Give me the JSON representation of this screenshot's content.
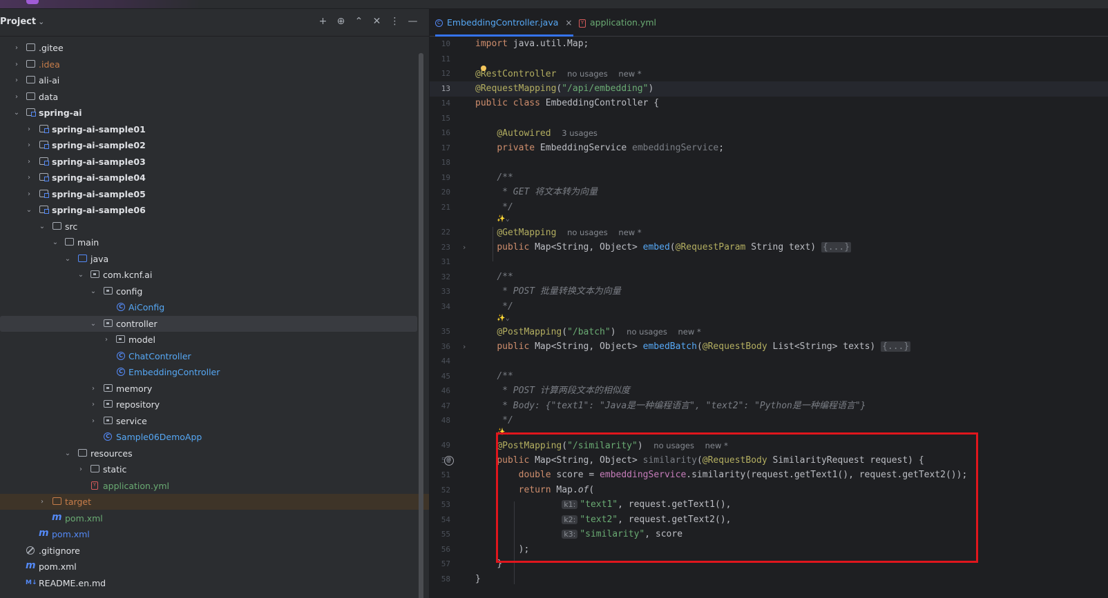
{
  "project": {
    "title": "Project",
    "tools": [
      {
        "name": "add-icon",
        "glyph": "+"
      },
      {
        "name": "locate-icon",
        "glyph": "⊕"
      },
      {
        "name": "expand-all-icon",
        "glyph": "⌃"
      },
      {
        "name": "collapse-all-icon",
        "glyph": "✕"
      },
      {
        "name": "more-options-icon",
        "glyph": "⋮"
      },
      {
        "name": "minimize-icon",
        "glyph": "—"
      }
    ],
    "tree": [
      {
        "label": ".gitee",
        "arrow": "›"
      },
      {
        "label": ".idea",
        "arrow": "›"
      },
      {
        "label": "ali-ai",
        "arrow": "›"
      },
      {
        "label": "data",
        "arrow": "›"
      },
      {
        "label": "spring-ai",
        "arrow": "⌄"
      },
      {
        "label": "spring-ai-sample01",
        "arrow": "›"
      },
      {
        "label": "spring-ai-sample02",
        "arrow": "›"
      },
      {
        "label": "spring-ai-sample03",
        "arrow": "›"
      },
      {
        "label": "spring-ai-sample04",
        "arrow": "›"
      },
      {
        "label": "spring-ai-sample05",
        "arrow": "›"
      },
      {
        "label": "spring-ai-sample06",
        "arrow": "⌄"
      },
      {
        "label": "src",
        "arrow": "⌄"
      },
      {
        "label": "main",
        "arrow": "⌄"
      },
      {
        "label": "java",
        "arrow": "⌄"
      },
      {
        "label": "com.kcnf.ai",
        "arrow": "⌄"
      },
      {
        "label": "config",
        "arrow": "⌄"
      },
      {
        "label": "AiConfig",
        "arrow": ""
      },
      {
        "label": "controller",
        "arrow": "⌄"
      },
      {
        "label": "model",
        "arrow": "›"
      },
      {
        "label": "ChatController",
        "arrow": ""
      },
      {
        "label": "EmbeddingController",
        "arrow": ""
      },
      {
        "label": "memory",
        "arrow": "›"
      },
      {
        "label": "repository",
        "arrow": "›"
      },
      {
        "label": "service",
        "arrow": "›"
      },
      {
        "label": "Sample06DemoApp",
        "arrow": ""
      },
      {
        "label": "resources",
        "arrow": "⌄"
      },
      {
        "label": "static",
        "arrow": "›"
      },
      {
        "label": "application.yml",
        "arrow": ""
      },
      {
        "label": "target",
        "arrow": "›"
      },
      {
        "label": "pom.xml",
        "arrow": ""
      },
      {
        "label": "pom.xml",
        "arrow": ""
      },
      {
        "label": ".gitignore",
        "arrow": ""
      },
      {
        "label": "pom.xml",
        "arrow": ""
      },
      {
        "label": "README.en.md",
        "arrow": ""
      }
    ]
  },
  "editor": {
    "tabs": [
      {
        "label": "EmbeddingController.java",
        "close": "×"
      },
      {
        "label": "application.yml"
      }
    ],
    "line_numbers": [
      "10",
      "11",
      "12",
      "13",
      "14",
      "15",
      "16",
      "17",
      "18",
      "19",
      "20",
      "21",
      "22",
      "23",
      "31",
      "32",
      "33",
      "34",
      "35",
      "36",
      "44",
      "45",
      "46",
      "47",
      "48",
      "49",
      "50",
      "51",
      "52",
      "53",
      "54",
      "55",
      "56",
      "57",
      "58"
    ],
    "code": {
      "l10_kw": "import",
      "l10_rest": " java.util.Map;",
      "l12_a": "@",
      "l12_b": "RestController",
      "hint_no_usages": "no usages",
      "hint_new": "new *",
      "hint_3_usages": "3 usages",
      "l13_an": "@RequestMapping",
      "l13_p1": "(",
      "l13_str": "\"/api/embedding\"",
      "l13_p2": ")",
      "l14_kw": "public class",
      "l14_cls": " EmbeddingController {",
      "l16_an": "@Autowired",
      "l17_kw": "private",
      "l17_type": " EmbeddingService ",
      "l17_fld": "embeddingService",
      "l17_end": ";",
      "c_open": "/**",
      "c_close": " */",
      "l20": " * GET 将文本转为向量",
      "ai_mark": "✨⌄",
      "l22_an": "@GetMapping",
      "pub": "public",
      "map_type": " Map<String, Object> ",
      "l23_fn": "embed",
      "l23_p": "(",
      "l23_an": "@RequestParam",
      "l23_rest": " String text) ",
      "fold": "{...}",
      "l33": " * POST 批量转换文本为向量",
      "l35_an": "@PostMapping",
      "l35_str": "\"/batch\"",
      "l36_fn": "embedBatch",
      "l36_an": "@RequestBody",
      "l36_rest": " List<String> texts) ",
      "l46": " * POST 计算两段文本的相似度",
      "l47": " * Body: {\"text1\": \"Java是一种编程语言\", \"text2\": \"Python是一种编程语言\"}",
      "l49_str": "\"/similarity\"",
      "l50_fn": "similarity",
      "l50_rest": " SimilarityRequest request) {",
      "l51_kw": "double",
      "l51_a": " score = ",
      "l51_fld": "embeddingService",
      "l51_b": ".similarity(request.getText1(), request.getText2());",
      "l52_kw": "return",
      "l52_a": " Map.",
      "l52_fn": "of",
      "l52_b": "(",
      "k1": "k1:",
      "k2": "k2:",
      "k3": "k3:",
      "l53_str": "\"text1\"",
      "l53_rest": ", request.getText1(),",
      "l54_str": "\"text2\"",
      "l54_rest": ", request.getText2(),",
      "l55_str": "\"similarity\"",
      "l55_rest": ", score",
      "l56": ");",
      "l57": "}",
      "l58": "}",
      "at": "@"
    }
  },
  "colors": {
    "highlight_box": "#e0161d",
    "accent": "#3574f0"
  }
}
